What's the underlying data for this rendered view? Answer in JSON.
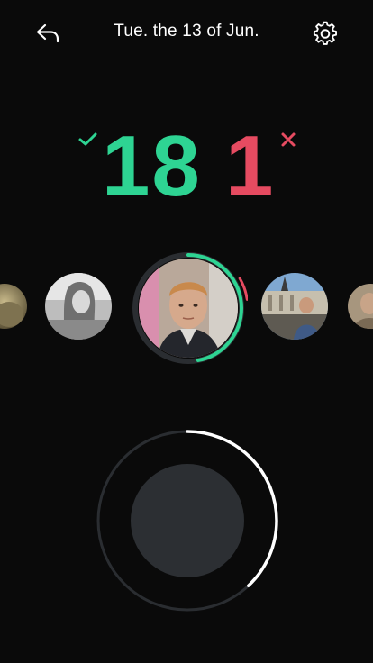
{
  "header": {
    "date_title": "Tue. the 13 of Jun."
  },
  "score": {
    "yes_count": "18",
    "no_count": "1"
  },
  "colors": {
    "yes": "#2ed493",
    "no": "#e64b61",
    "background": "#0a0a0a",
    "track": "#2a2d31",
    "record_button": "#2c2f33"
  },
  "icons": {
    "back": "back-arrow-icon",
    "settings": "gear-icon",
    "yes": "check-icon",
    "no": "x-icon"
  },
  "carousel": {
    "items": [
      {
        "name": "friend-1",
        "state": "partial"
      },
      {
        "name": "friend-2",
        "state": "grayscale"
      },
      {
        "name": "friend-3",
        "state": "selected"
      },
      {
        "name": "friend-4",
        "state": "normal"
      },
      {
        "name": "friend-5",
        "state": "partial"
      }
    ],
    "selected_progress_yes": 0.47,
    "selected_progress_no": 0.06
  },
  "record": {
    "progress": 0.38
  }
}
